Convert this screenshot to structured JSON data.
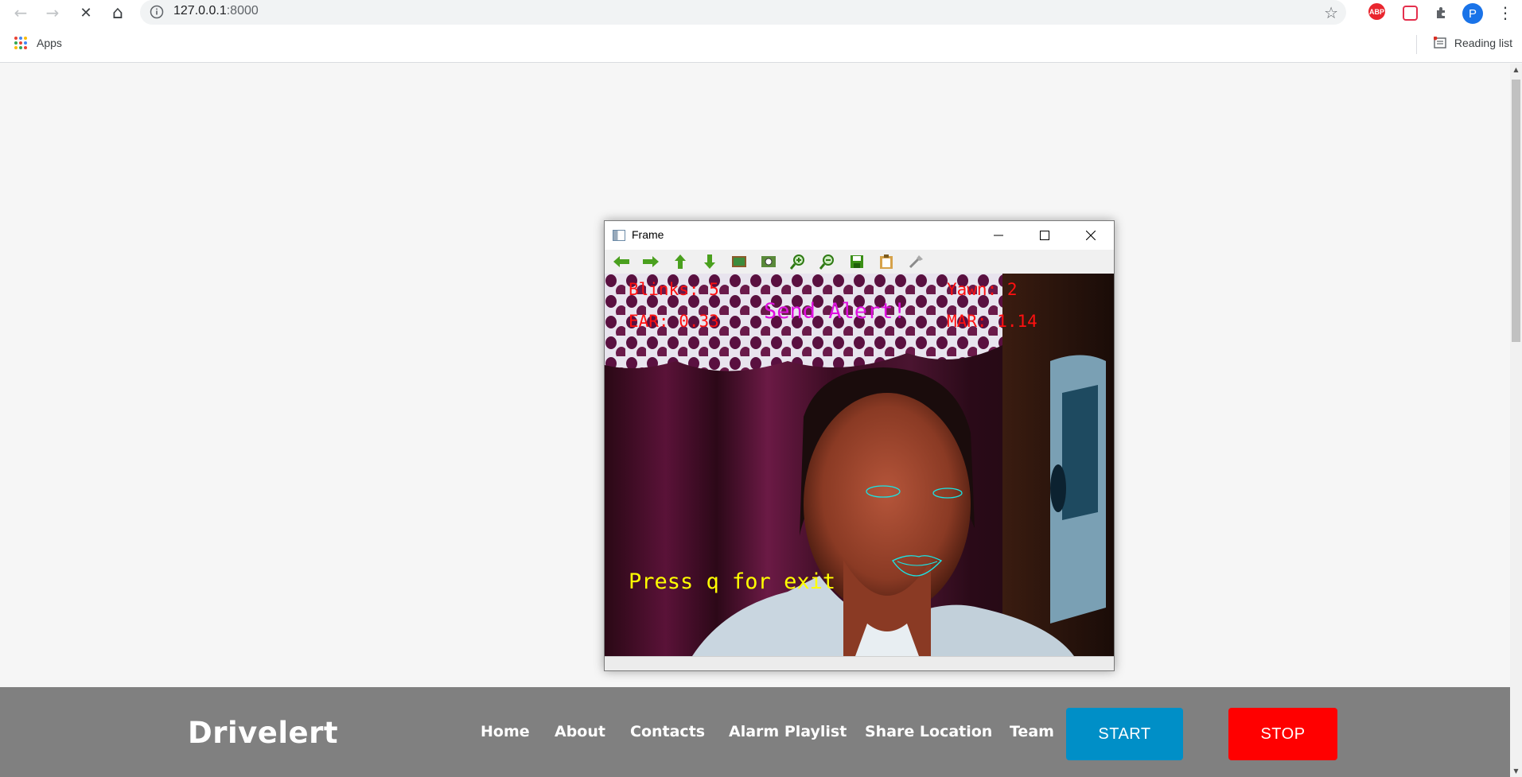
{
  "browser": {
    "url_host": "127.0.0.1",
    "url_port": ":8000",
    "back_icon": "←",
    "forward_icon": "→",
    "stop_icon": "✕",
    "home_icon": "⌂",
    "star_icon": "☆",
    "abp_label": "ABP",
    "avatar_letter": "P",
    "menu_icon": "⋮",
    "extensions_icon": "puzzle-icon"
  },
  "bookmarks": {
    "apps_label": "Apps",
    "reading_list_label": "Reading list"
  },
  "frame_window": {
    "title": "Frame",
    "minimize": "—",
    "maximize": "☐",
    "close": "✕",
    "overlay": {
      "blinks": "Blinks: 5",
      "ear": "EAR: 0.33",
      "alert": "Send Alert!",
      "yawn": "Yawn: 2",
      "mar": "MAR: 1.14",
      "exit_hint": "Press q for exit"
    }
  },
  "site": {
    "brand": "Drivelert",
    "nav": [
      "Home",
      "About",
      "Contacts",
      "Alarm Playlist",
      "Share Location",
      "Team"
    ],
    "start_label": "START",
    "stop_label": "STOP"
  },
  "colors": {
    "footer_bg": "#808080",
    "start_bg": "#008fc7",
    "stop_bg": "#ff0000"
  }
}
